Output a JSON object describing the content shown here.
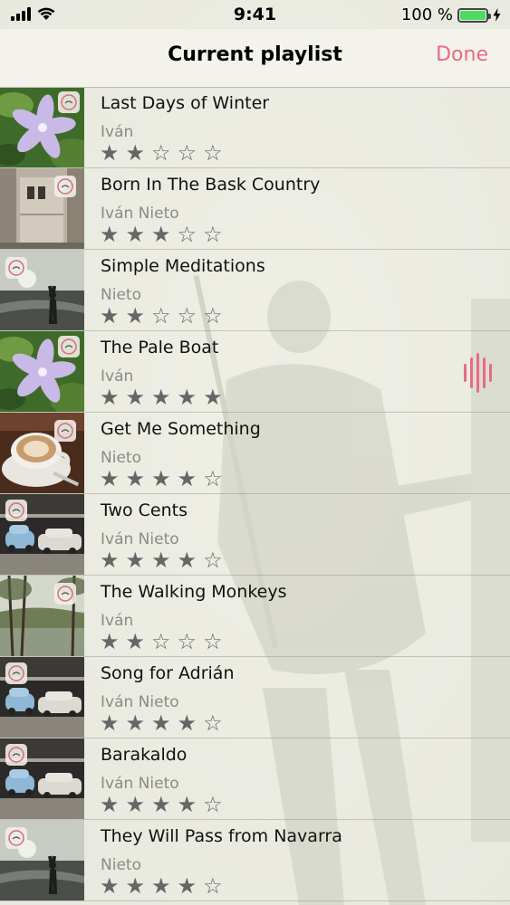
{
  "status_bar": {
    "time": "9:41",
    "battery": "100 %"
  },
  "nav": {
    "title": "Current playlist",
    "done_label": "Done"
  },
  "colors": {
    "accent": "#e86a85",
    "battery_green": "#4cd964"
  },
  "songs": [
    {
      "title": "Last Days of Winter",
      "artist": "Iván",
      "rating": 2,
      "thumb": "flower-photo",
      "playing": false
    },
    {
      "title": "Born In The Bask Country",
      "artist": "Iván Nieto",
      "rating": 3,
      "thumb": "doorway-photo",
      "playing": false
    },
    {
      "title": "Simple Meditations",
      "artist": "Nieto",
      "rating": 2,
      "thumb": "lake-silhouette-photo",
      "playing": false
    },
    {
      "title": "The Pale Boat",
      "artist": "Iván",
      "rating": 5,
      "thumb": "flower-photo",
      "playing": true
    },
    {
      "title": "Get Me Something",
      "artist": "Nieto",
      "rating": 4,
      "thumb": "coffee-cup-photo",
      "playing": false
    },
    {
      "title": "Two Cents",
      "artist": "Iván Nieto",
      "rating": 4,
      "thumb": "vintage-cars-photo",
      "playing": false
    },
    {
      "title": "The Walking Monkeys",
      "artist": "Iván",
      "rating": 2,
      "thumb": "forest-lake-photo",
      "playing": false
    },
    {
      "title": "Song for Adrián",
      "artist": "Iván Nieto",
      "rating": 4,
      "thumb": "vintage-cars-photo",
      "playing": false
    },
    {
      "title": "Barakaldo",
      "artist": "Iván Nieto",
      "rating": 4,
      "thumb": "vintage-cars-photo",
      "playing": false
    },
    {
      "title": "They Will Pass from Navarra",
      "artist": "Nieto",
      "rating": 4,
      "thumb": "lake-silhouette-photo",
      "playing": false
    }
  ]
}
